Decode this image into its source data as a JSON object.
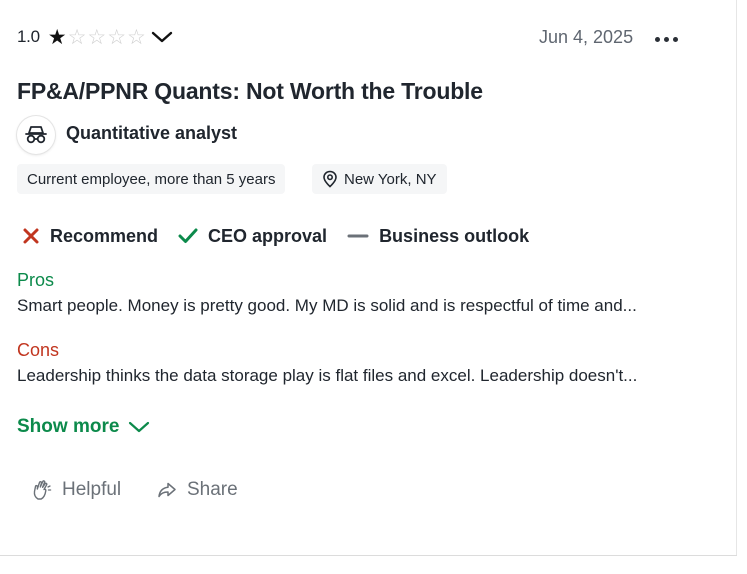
{
  "review": {
    "rating_value": "1.0",
    "rating_stars": 1,
    "stars_total": 5,
    "date": "Jun 4, 2025",
    "title": "FP&A/PPNR Quants: Not Worth the Trouble",
    "job_title": "Quantitative analyst",
    "tags": {
      "employment": "Current employee, more than 5 years",
      "location": "New York, NY"
    },
    "indicators": {
      "recommend": "Recommend",
      "ceo_approval": "CEO approval",
      "business_outlook": "Business outlook"
    },
    "pros_heading": "Pros",
    "pros_text": "Smart people. Money is pretty good. My MD is solid and is respectful of time and...",
    "cons_heading": "Cons",
    "cons_text": "Leadership thinks the data storage play is flat files and excel. Leadership doesn't...",
    "show_more": "Show more",
    "actions": {
      "helpful": "Helpful",
      "share": "Share"
    }
  },
  "icons": {
    "logo": "spy-glasses-logo-icon",
    "location": "location-pin-icon",
    "recommend": "x-mark-icon",
    "ceo_approval": "check-icon",
    "business_outlook": "dash-icon",
    "helpful": "clapping-hands-icon",
    "share": "share-arrow-icon"
  },
  "colors": {
    "green": "#0c8a4b",
    "red": "#c1351f",
    "neutral": "#6b7178",
    "text": "#20262e"
  }
}
